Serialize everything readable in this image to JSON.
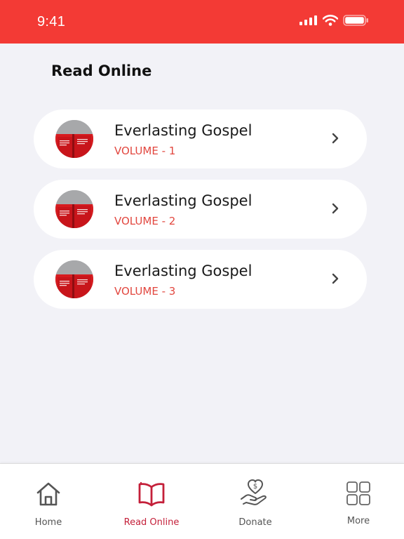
{
  "status_bar": {
    "time": "9:41"
  },
  "page": {
    "title": "Read Online"
  },
  "books": [
    {
      "name": "Everlasting Gospel",
      "volume": "VOLUME - 1"
    },
    {
      "name": "Everlasting Gospel",
      "volume": "VOLUME - 2"
    },
    {
      "name": "Everlasting Gospel",
      "volume": "VOLUME - 3"
    }
  ],
  "tab_bar": {
    "tabs": [
      {
        "label": "Home",
        "icon": "home-icon"
      },
      {
        "label": "Read Online",
        "icon": "open-book-icon",
        "active": true
      },
      {
        "label": "Donate",
        "icon": "donate-hand-icon"
      },
      {
        "label": "More",
        "icon": "grid-icon"
      }
    ]
  },
  "colors": {
    "accent": "#f33a35",
    "active_tab": "#c4203a",
    "volume_text": "#e2473f",
    "background": "#f2f2f7"
  }
}
